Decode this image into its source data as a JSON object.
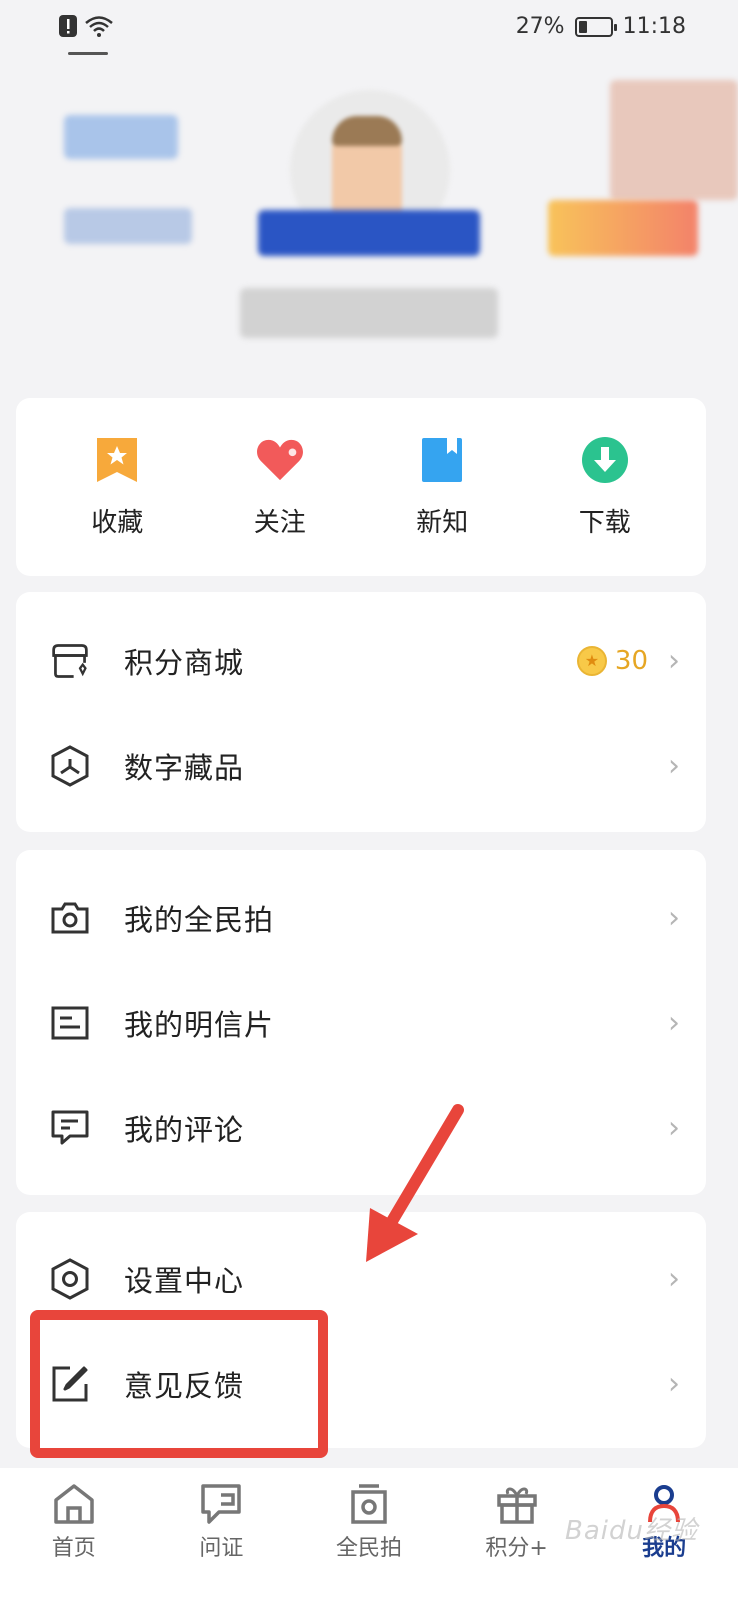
{
  "status_bar": {
    "battery_text": "27%",
    "battery_level": 0.27,
    "time": "11:18"
  },
  "quick_actions": [
    {
      "label": "收藏",
      "icon": "bookmark-star-icon",
      "color": "#f7a93b"
    },
    {
      "label": "关注",
      "icon": "heart-icon",
      "color": "#f25a5a"
    },
    {
      "label": "新知",
      "icon": "book-icon",
      "color": "#35a4f0"
    },
    {
      "label": "下载",
      "icon": "download-icon",
      "color": "#2bc38f"
    }
  ],
  "group1": [
    {
      "label": "积分商城",
      "icon": "shop-icon",
      "points": "30"
    },
    {
      "label": "数字藏品",
      "icon": "cube-icon"
    }
  ],
  "group2": [
    {
      "label": "我的全民拍",
      "icon": "camera-icon"
    },
    {
      "label": "我的明信片",
      "icon": "postcard-icon"
    },
    {
      "label": "我的评论",
      "icon": "comment-icon"
    }
  ],
  "group3": [
    {
      "label": "设置中心",
      "icon": "settings-icon"
    },
    {
      "label": "意见反馈",
      "icon": "edit-icon"
    }
  ],
  "bottom_nav": [
    {
      "label": "首页",
      "icon": "home-icon",
      "active": false
    },
    {
      "label": "问证",
      "icon": "question-icon",
      "active": false
    },
    {
      "label": "全民拍",
      "icon": "camera-box-icon",
      "active": false
    },
    {
      "label": "积分+",
      "icon": "gift-icon",
      "active": false
    },
    {
      "label": "我的",
      "icon": "user-icon",
      "active": true
    }
  ],
  "chevron": "›",
  "watermark": "Baidu经验"
}
